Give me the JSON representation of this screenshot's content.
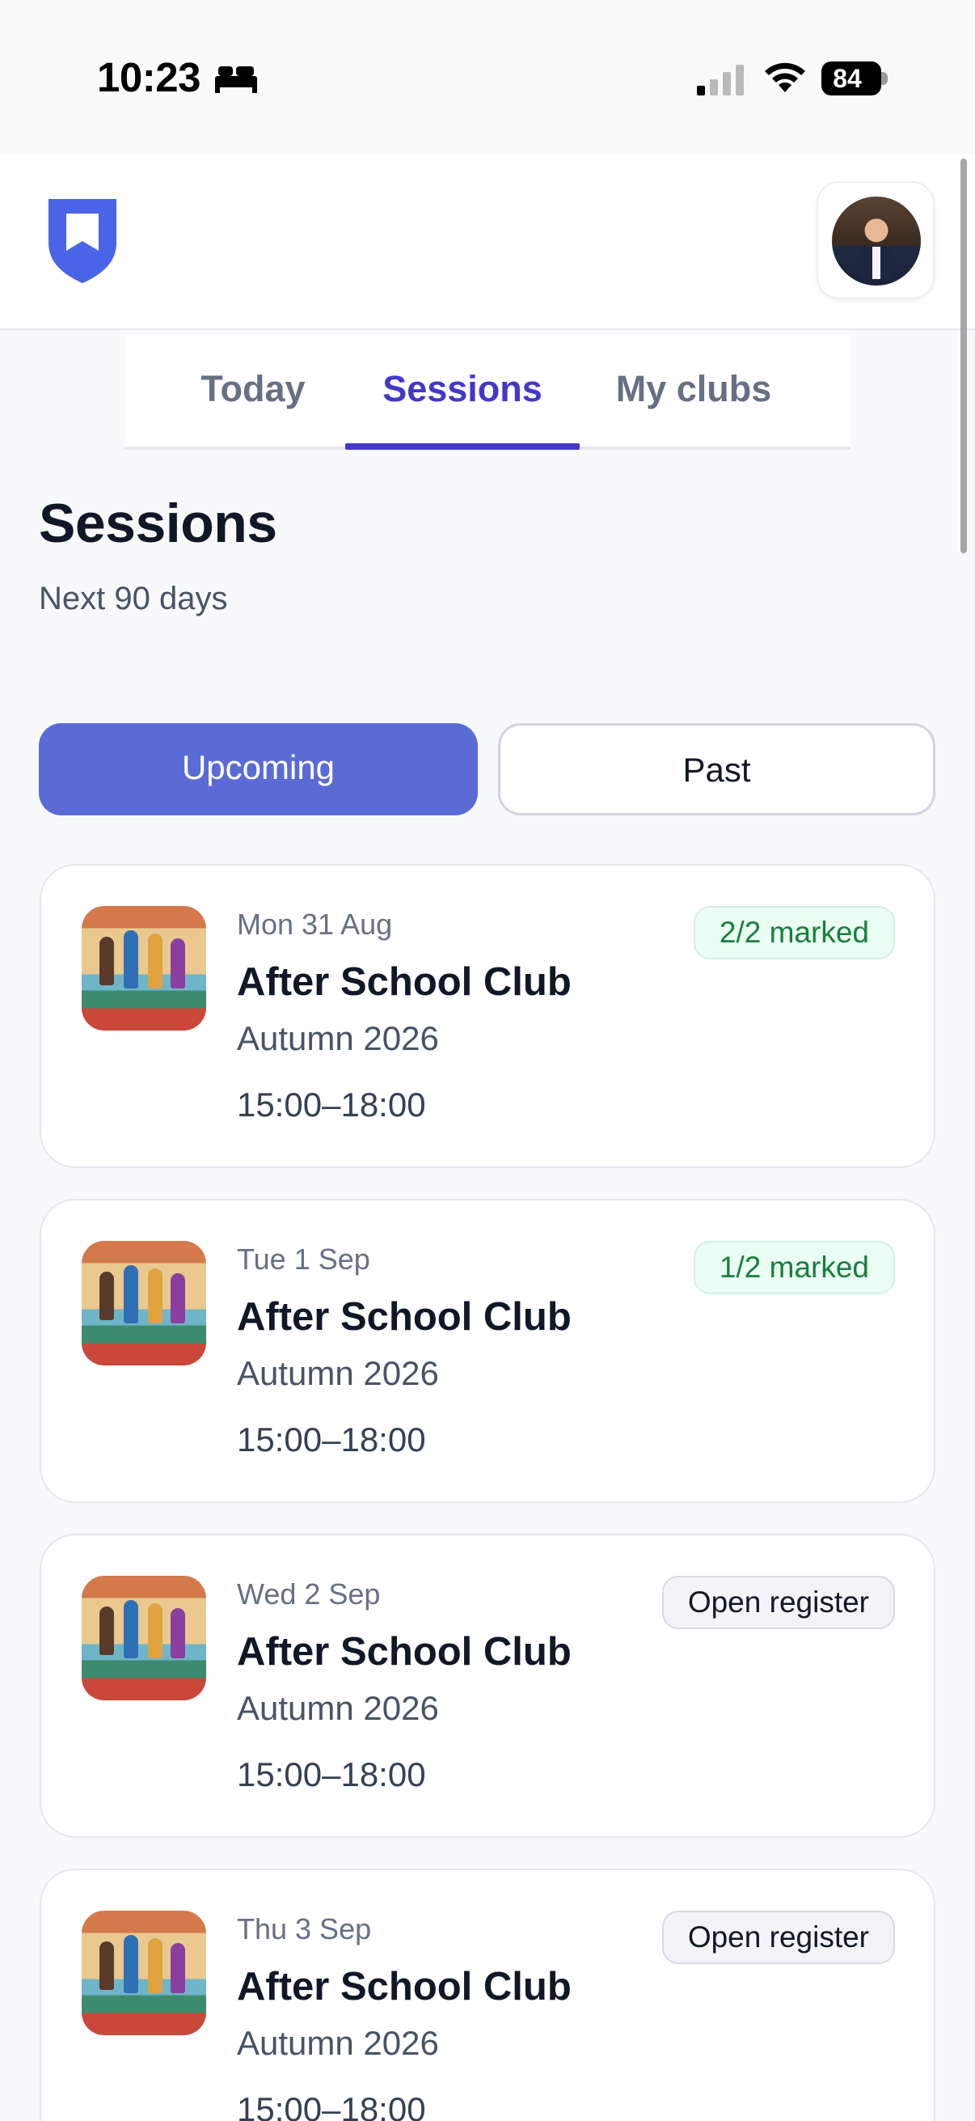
{
  "status_bar": {
    "time": "10:23",
    "battery": "84",
    "icons": [
      "bed-icon",
      "cellular-signal-icon",
      "wifi-icon",
      "battery-icon"
    ]
  },
  "header": {
    "logo_icon": "shield-logo-icon",
    "avatar": "user-avatar"
  },
  "tabs": [
    {
      "label": "Today",
      "active": false
    },
    {
      "label": "Sessions",
      "active": true
    },
    {
      "label": "My clubs",
      "active": false
    }
  ],
  "page": {
    "title": "Sessions",
    "subtitle": "Next 90 days"
  },
  "filter": {
    "upcoming": "Upcoming",
    "past": "Past",
    "selected": "Upcoming"
  },
  "sessions": [
    {
      "date": "Mon 31 Aug",
      "title": "After School Club",
      "term": "Autumn 2026",
      "time": "15:00–18:00",
      "badge": "2/2 marked",
      "badge_type": "green"
    },
    {
      "date": "Tue 1 Sep",
      "title": "After School Club",
      "term": "Autumn 2026",
      "time": "15:00–18:00",
      "badge": "1/2 marked",
      "badge_type": "green"
    },
    {
      "date": "Wed 2 Sep",
      "title": "After School Club",
      "term": "Autumn 2026",
      "time": "15:00–18:00",
      "badge": "Open register",
      "badge_type": "gray"
    },
    {
      "date": "Thu 3 Sep",
      "title": "After School Club",
      "term": "Autumn 2026",
      "time": "15:00–18:00",
      "badge": "Open register",
      "badge_type": "gray"
    }
  ],
  "colors": {
    "accent": "#4338ca",
    "segment_active": "#5b6bd6",
    "badge_green_text": "#15803d",
    "badge_green_bg": "#ecfdf3",
    "badge_gray_bg": "#f2f4f7",
    "logo": "#4a63e7"
  }
}
